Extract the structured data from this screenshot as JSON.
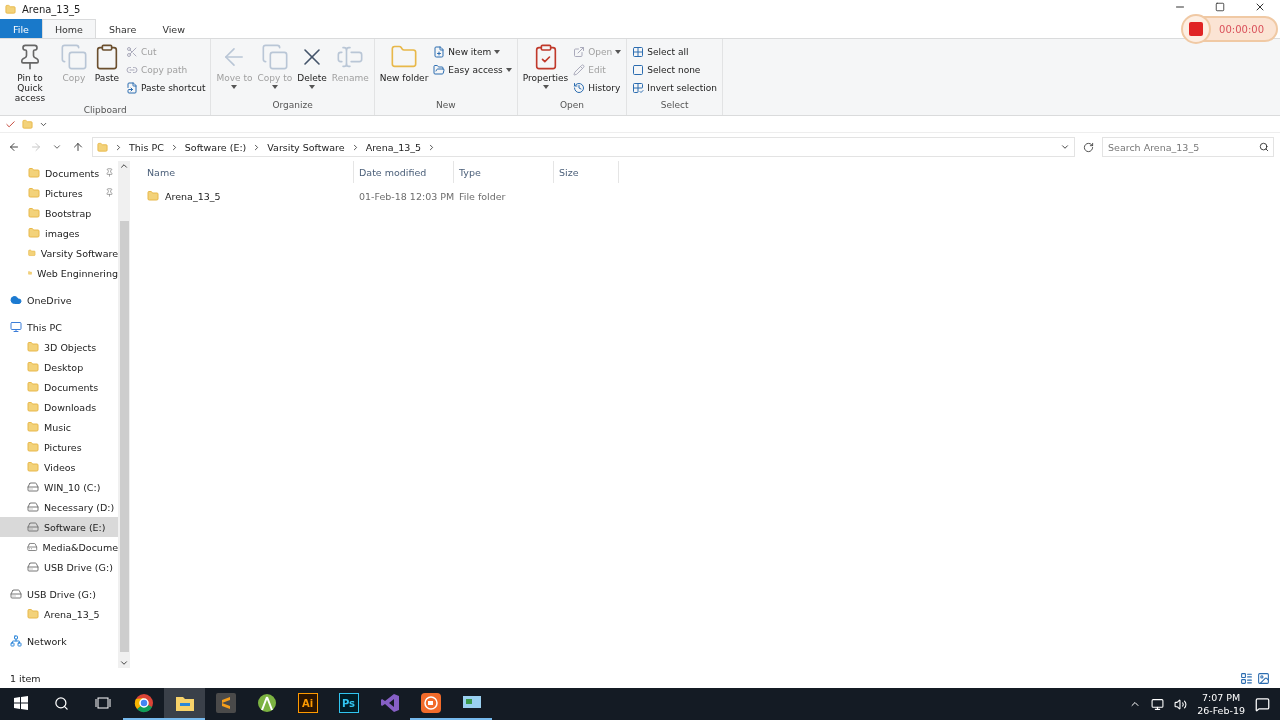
{
  "window": {
    "title": "Arena_13_5"
  },
  "recorder": {
    "time": "00:00:00"
  },
  "ribbon_tabs": [
    {
      "label": "File",
      "kind": "file",
      "selected": false
    },
    {
      "label": "Home",
      "kind": "tab",
      "selected": true
    },
    {
      "label": "Share",
      "kind": "tab",
      "selected": false
    },
    {
      "label": "View",
      "kind": "tab",
      "selected": false
    }
  ],
  "ribbon_groups": [
    {
      "label": "Clipboard",
      "items": [
        {
          "label": "Pin to Quick access",
          "kind": "large",
          "disabled": false,
          "dropdown": false
        },
        {
          "label": "Copy",
          "kind": "large",
          "disabled": true,
          "dropdown": false
        },
        {
          "label": "Paste",
          "kind": "large",
          "disabled": false,
          "dropdown": false
        },
        {
          "label": "Cut",
          "kind": "small",
          "disabled": true,
          "dropdown": false
        },
        {
          "label": "Copy path",
          "kind": "small",
          "disabled": true,
          "dropdown": false
        },
        {
          "label": "Paste shortcut",
          "kind": "small",
          "disabled": false,
          "dropdown": false
        }
      ]
    },
    {
      "label": "Organize",
      "items": [
        {
          "label": "Move to",
          "kind": "large",
          "disabled": true,
          "dropdown": true
        },
        {
          "label": "Copy to",
          "kind": "large",
          "disabled": true,
          "dropdown": true
        },
        {
          "label": "Delete",
          "kind": "large",
          "disabled": false,
          "dropdown": true
        },
        {
          "label": "Rename",
          "kind": "large",
          "disabled": true,
          "dropdown": false
        }
      ]
    },
    {
      "label": "New",
      "items": [
        {
          "label": "New folder",
          "kind": "large",
          "disabled": false,
          "dropdown": false
        },
        {
          "label": "New item",
          "kind": "small",
          "disabled": false,
          "dropdown": true
        },
        {
          "label": "Easy access",
          "kind": "small",
          "disabled": false,
          "dropdown": true
        }
      ]
    },
    {
      "label": "Open",
      "items": [
        {
          "label": "Properties",
          "kind": "large",
          "disabled": false,
          "dropdown": true
        },
        {
          "label": "Open",
          "kind": "small",
          "disabled": true,
          "dropdown": true
        },
        {
          "label": "Edit",
          "kind": "small",
          "disabled": true,
          "dropdown": false
        },
        {
          "label": "History",
          "kind": "small",
          "disabled": false,
          "dropdown": false
        }
      ]
    },
    {
      "label": "Select",
      "items": [
        {
          "label": "Select all",
          "kind": "small",
          "disabled": false,
          "dropdown": false
        },
        {
          "label": "Select none",
          "kind": "small",
          "disabled": false,
          "dropdown": false
        },
        {
          "label": "Invert selection",
          "kind": "small",
          "disabled": false,
          "dropdown": false
        }
      ]
    }
  ],
  "address_bar": {
    "path": [
      "This PC",
      "Software (E:)",
      "Varsity Software",
      "Arena_13_5"
    ]
  },
  "search": {
    "placeholder": "Search Arena_13_5"
  },
  "quick_access_items": [
    {
      "label": "Documents",
      "pinned": true,
      "selected": false
    },
    {
      "label": "Pictures",
      "pinned": true,
      "selected": false
    },
    {
      "label": "Bootstrap",
      "pinned": false,
      "selected": false
    },
    {
      "label": "images",
      "pinned": false,
      "selected": false
    },
    {
      "label": "Varsity Software",
      "pinned": false,
      "selected": false
    },
    {
      "label": "Web Enginnering",
      "pinned": false,
      "selected": false
    }
  ],
  "nav_items": [
    {
      "label": "OneDrive",
      "kind": "cloud",
      "selected": false
    },
    {
      "label": "This PC",
      "kind": "pc",
      "selected": false,
      "children": [
        {
          "label": "3D Objects",
          "kind": "folder",
          "selected": false
        },
        {
          "label": "Desktop",
          "kind": "folder",
          "selected": false
        },
        {
          "label": "Documents",
          "kind": "folder",
          "selected": false
        },
        {
          "label": "Downloads",
          "kind": "folder",
          "selected": false
        },
        {
          "label": "Music",
          "kind": "folder",
          "selected": false
        },
        {
          "label": "Pictures",
          "kind": "folder",
          "selected": false
        },
        {
          "label": "Videos",
          "kind": "folder",
          "selected": false
        },
        {
          "label": "WIN_10 (C:)",
          "kind": "drive",
          "selected": false
        },
        {
          "label": "Necessary (D:)",
          "kind": "drive",
          "selected": false
        },
        {
          "label": "Software (E:)",
          "kind": "drive",
          "selected": true
        },
        {
          "label": "Media&Docume",
          "kind": "drive",
          "selected": false
        },
        {
          "label": "USB Drive (G:)",
          "kind": "drive",
          "selected": false
        }
      ]
    },
    {
      "label": "USB Drive (G:)",
      "kind": "drive",
      "selected": false,
      "children": [
        {
          "label": "Arena_13_5",
          "kind": "folder",
          "selected": false
        }
      ]
    },
    {
      "label": "Network",
      "kind": "network",
      "selected": false
    }
  ],
  "table": {
    "columns": [
      "Name",
      "Date modified",
      "Type",
      "Size"
    ],
    "rows": [
      {
        "name": "Arena_13_5",
        "date_modified": "01-Feb-18 12:03 PM",
        "type": "File folder"
      }
    ]
  },
  "status_bar": {
    "count": "1 item"
  },
  "taskbar": {
    "apps": [
      {
        "kind": "chrome",
        "running": true,
        "selected": false
      },
      {
        "kind": "explorer",
        "running": true,
        "selected": true
      },
      {
        "kind": "sublime",
        "running": false,
        "selected": false
      },
      {
        "kind": "android",
        "running": false,
        "selected": false
      },
      {
        "kind": "ai",
        "label": "Ai",
        "running": false,
        "selected": false
      },
      {
        "kind": "ps",
        "label": "Ps",
        "running": false,
        "selected": false
      },
      {
        "kind": "vs",
        "running": false,
        "selected": false
      },
      {
        "kind": "recorder",
        "running": true,
        "selected": false
      },
      {
        "kind": "remote",
        "running": true,
        "selected": false
      }
    ],
    "time": "7:07 PM",
    "date": "26-Feb-19"
  }
}
